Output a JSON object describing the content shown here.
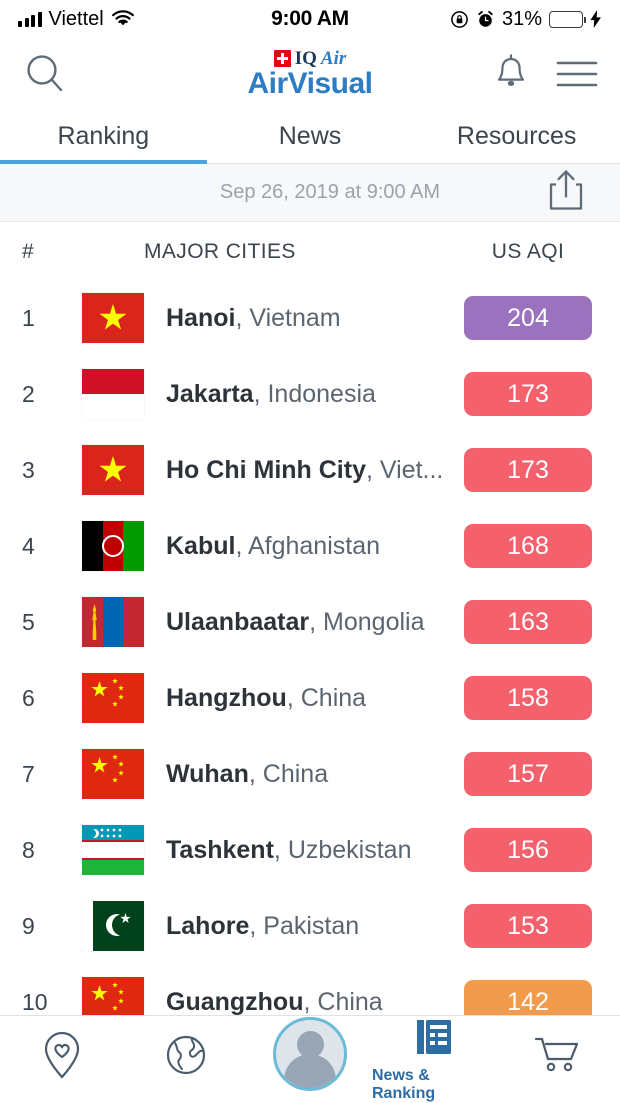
{
  "status_bar": {
    "carrier": "Viettel",
    "time": "9:00 AM",
    "battery_percent": "31%",
    "icons": [
      "signal-bars-icon",
      "wifi-icon",
      "rotation-lock-icon",
      "alarm-clock-icon",
      "battery-icon",
      "charging-bolt-icon"
    ]
  },
  "header": {
    "search_icon": "search-icon",
    "notification_icon": "bell-icon",
    "menu_icon": "hamburger-menu-icon",
    "brand_iq": "IQ",
    "brand_air": "Air",
    "brand_main": "AirVisual"
  },
  "tabs": [
    {
      "label": "Ranking",
      "active": true
    },
    {
      "label": "News",
      "active": false
    },
    {
      "label": "Resources",
      "active": false
    }
  ],
  "date_bar": {
    "text": "Sep 26, 2019 at 9:00 AM",
    "share_icon": "share-icon"
  },
  "table": {
    "headers": {
      "rank": "#",
      "city": "MAJOR CITIES",
      "aqi": "US AQI"
    },
    "rows": [
      {
        "rank": "1",
        "city": "Hanoi",
        "country": "Vietnam",
        "aqi": "204",
        "color": "#9B72BE",
        "flag": "vn"
      },
      {
        "rank": "2",
        "city": "Jakarta",
        "country": "Indonesia",
        "aqi": "173",
        "color": "#F4616C",
        "flag": "id"
      },
      {
        "rank": "3",
        "city": "Ho Chi Minh City",
        "country": "Viet...",
        "aqi": "173",
        "color": "#F4616C",
        "flag": "vn"
      },
      {
        "rank": "4",
        "city": "Kabul",
        "country": "Afghanistan",
        "aqi": "168",
        "color": "#F4616C",
        "flag": "af"
      },
      {
        "rank": "5",
        "city": "Ulaanbaatar",
        "country": "Mongolia",
        "aqi": "163",
        "color": "#F4616C",
        "flag": "mn"
      },
      {
        "rank": "6",
        "city": "Hangzhou",
        "country": "China",
        "aqi": "158",
        "color": "#F4616C",
        "flag": "cn"
      },
      {
        "rank": "7",
        "city": "Wuhan",
        "country": "China",
        "aqi": "157",
        "color": "#F4616C",
        "flag": "cn"
      },
      {
        "rank": "8",
        "city": "Tashkent",
        "country": "Uzbekistan",
        "aqi": "156",
        "color": "#F4616C",
        "flag": "uz"
      },
      {
        "rank": "9",
        "city": "Lahore",
        "country": "Pakistan",
        "aqi": "153",
        "color": "#F4616C",
        "flag": "pk"
      },
      {
        "rank": "10",
        "city": "Guangzhou",
        "country": "China",
        "aqi": "142",
        "color": "#F39B4D",
        "flag": "cn"
      }
    ]
  },
  "bottom_nav": [
    {
      "icon": "favorites-pin-heart-icon",
      "label": "",
      "active": false
    },
    {
      "icon": "globe-map-icon",
      "label": "",
      "active": false
    },
    {
      "icon": "profile-avatar-icon",
      "label": "",
      "active": false
    },
    {
      "icon": "news-ranking-icon",
      "label": "News & Ranking",
      "active": true
    },
    {
      "icon": "shopping-cart-icon",
      "label": "",
      "active": false
    }
  ]
}
